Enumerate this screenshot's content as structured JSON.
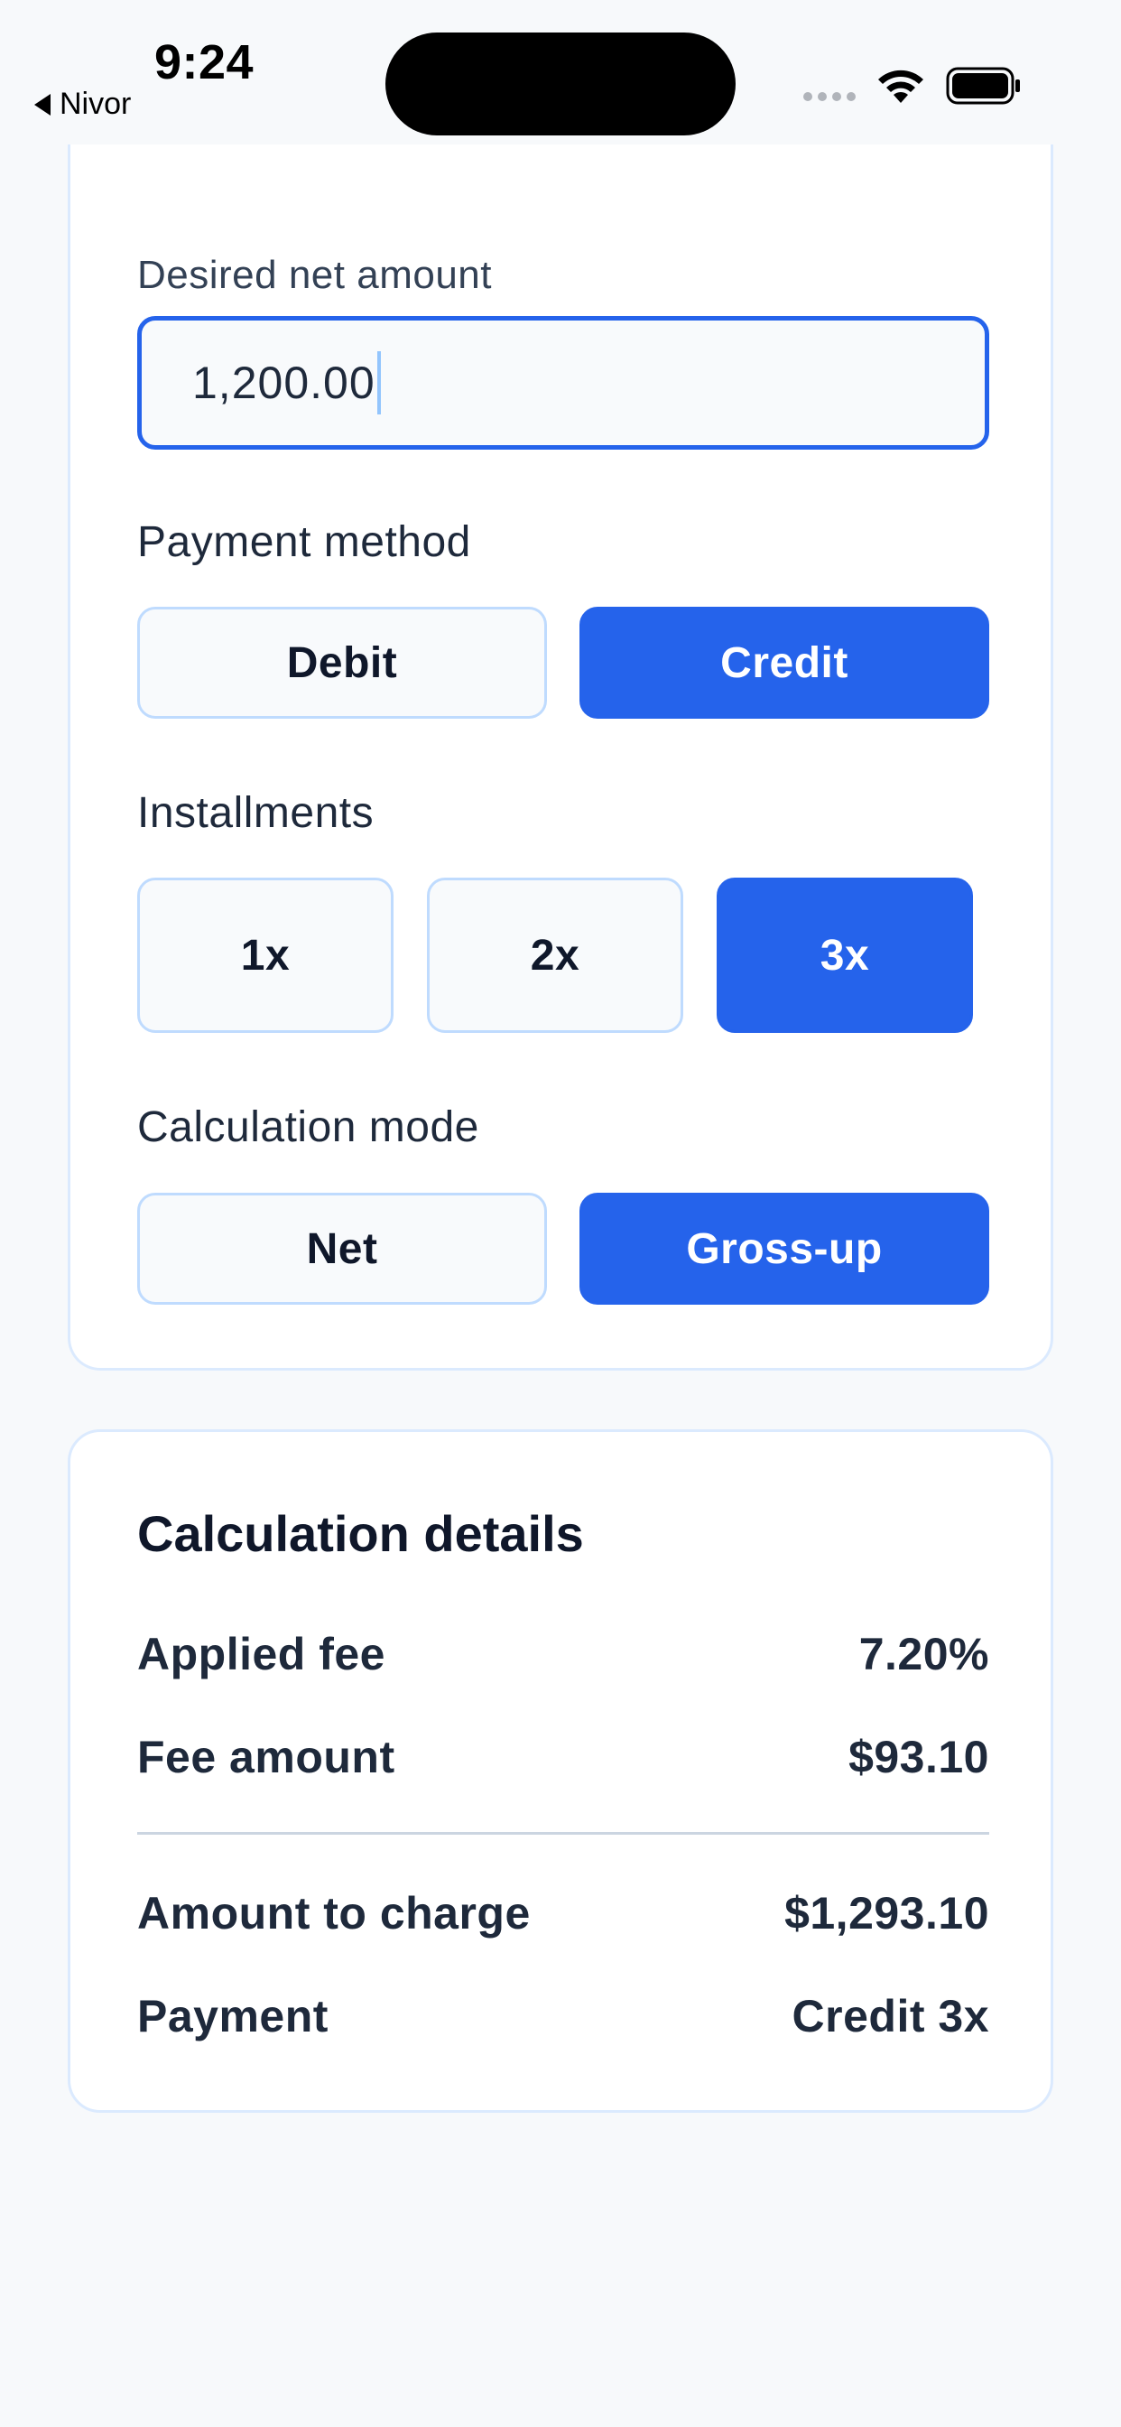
{
  "status_bar": {
    "time": "9:24",
    "back_label": "Nivor"
  },
  "form": {
    "net_amount_label": "Desired net amount",
    "net_amount_value": "1,200.00",
    "payment_method_label": "Payment method",
    "payment_methods": [
      "Debit",
      "Credit"
    ],
    "selected_payment_method": "Credit",
    "installments_label": "Installments",
    "installments": [
      "1x",
      "2x",
      "3x"
    ],
    "selected_installment": "3x",
    "calculation_mode_label": "Calculation mode",
    "calculation_modes": [
      "Net",
      "Gross-up"
    ],
    "selected_calculation_mode": "Gross-up"
  },
  "details": {
    "title": "Calculation details",
    "applied_fee_label": "Applied fee",
    "applied_fee_value": "7.20%",
    "fee_amount_label": "Fee amount",
    "fee_amount_value": "$93.10",
    "amount_to_charge_label": "Amount to charge",
    "amount_to_charge_value": "$1,293.10",
    "payment_label": "Payment",
    "payment_value": "Credit 3x"
  },
  "colors": {
    "accent": "#2563eb",
    "card_border": "#dbeafe",
    "background": "#f7f9fb"
  }
}
